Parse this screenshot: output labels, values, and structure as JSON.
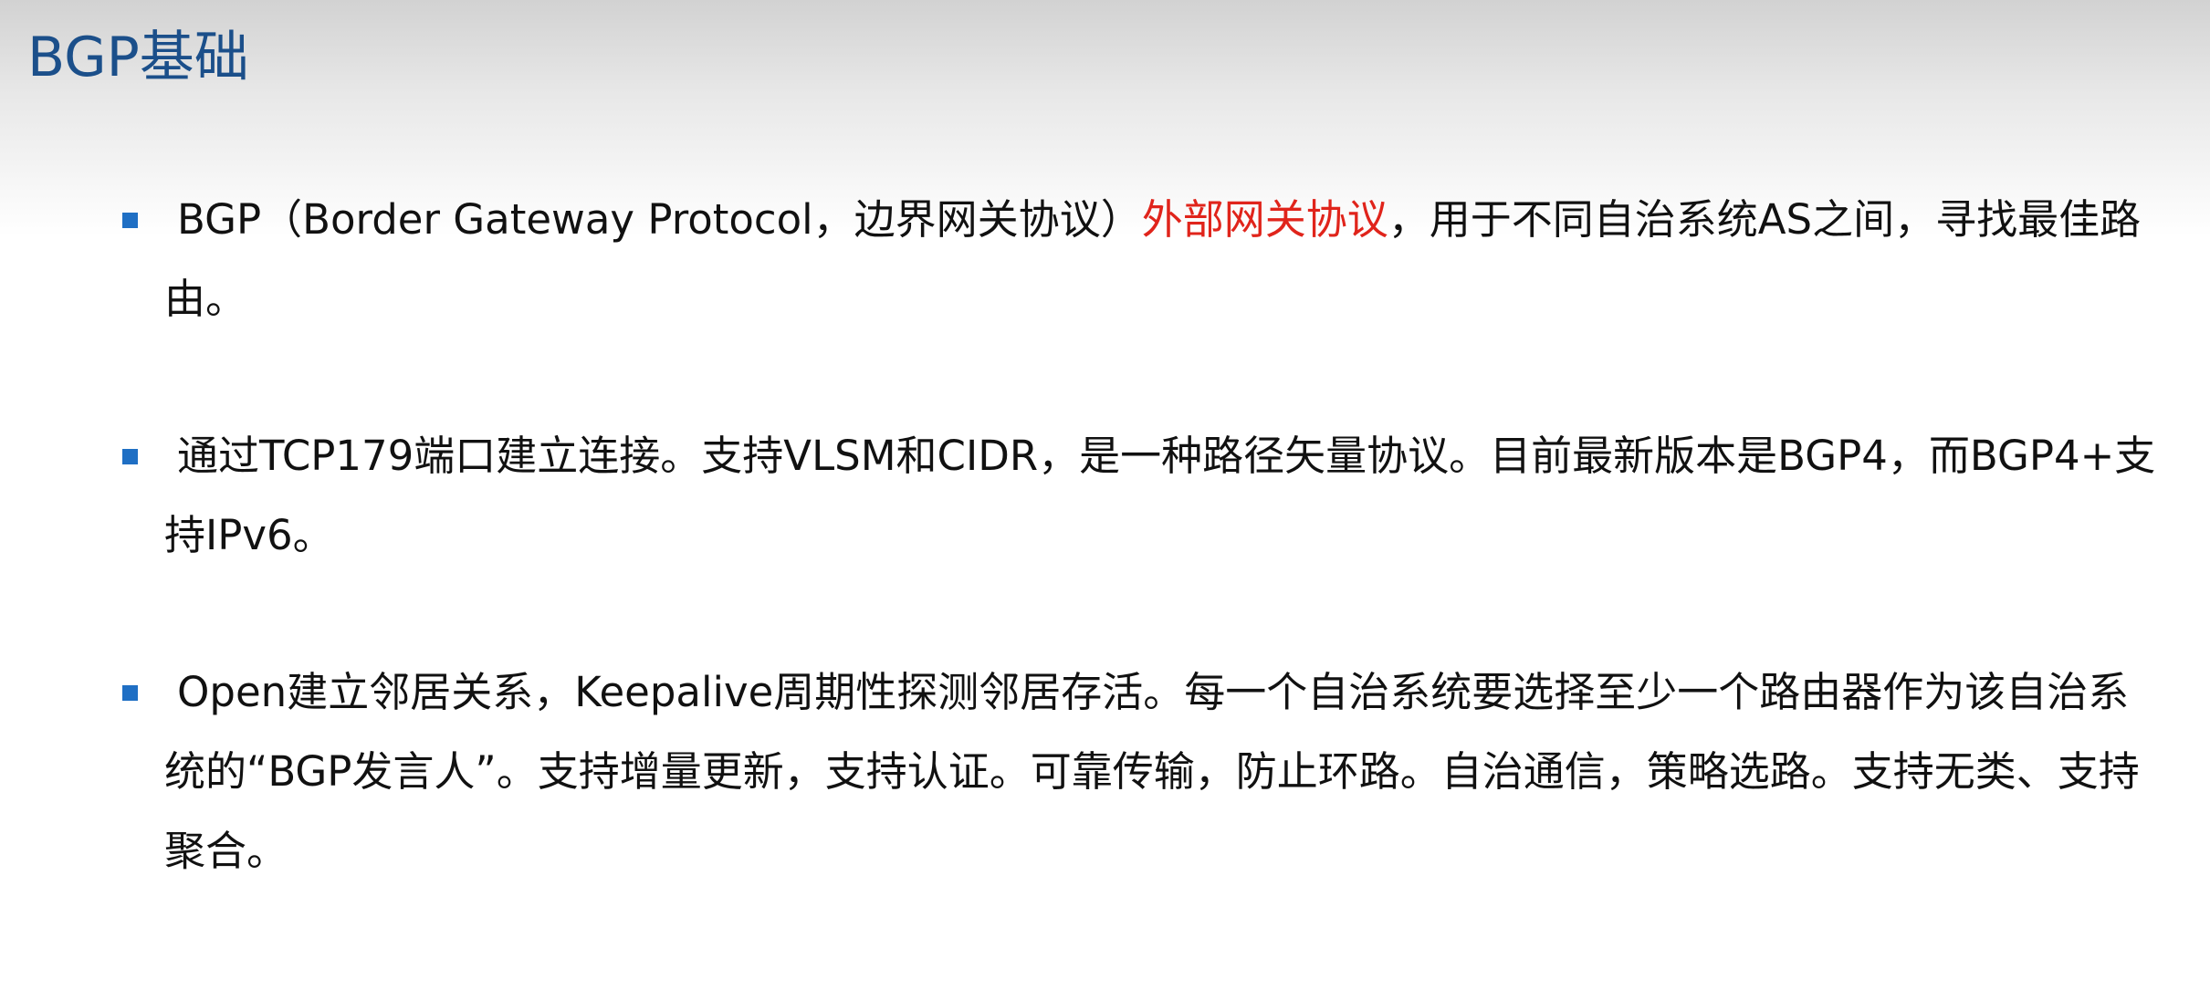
{
  "slide": {
    "title": "BGP基础",
    "accent_color": "#1b4f8a",
    "bullet_color": "#1f6fc4",
    "highlight_color": "#e0241b"
  },
  "bullets": [
    {
      "text_before": "BGP（Border Gateway Protocol，边界网关协议）",
      "highlight": "外部网关协议",
      "text_after": "，用于不同自治系统AS之间，寻找最佳路由。"
    },
    {
      "text": "通过TCP179端口建立连接。支持VLSM和CIDR，是一种路径矢量协议。目前最新版本是BGP4，而BGP4+支持IPv6。"
    },
    {
      "text": "Open建立邻居关系，Keepalive周期性探测邻居存活。每一个自治系统要选择至少一个路由器作为该自治系统的“BGP发言人”。支持增量更新，支持认证。可靠传输，防止环路。自治通信，策略选路。支持无类、支持聚合。"
    }
  ],
  "icons": {
    "bullet_marker": "square-bullet-icon"
  }
}
